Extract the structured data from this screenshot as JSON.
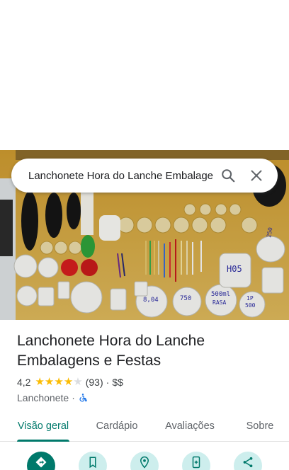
{
  "search": {
    "value": "Lanchonete Hora do Lanche Embalagens e Festas",
    "search_icon": "search-icon",
    "close_icon": "close-icon"
  },
  "place": {
    "name": "Lanchonete Hora do Lanche Embalagens e Festas",
    "rating": "4,2",
    "rating_value": 4.2,
    "stars_max": 5,
    "reviews_count": "(93)",
    "separator": "·",
    "price_level": "$$",
    "category": "Lanchonete",
    "category_separator": "·",
    "accessibility_icon": "wheelchair-icon"
  },
  "photo": {
    "sign_1": "H05",
    "sign_2": "500ml",
    "sign_2b": "RASA",
    "sign_3": "1P",
    "sign_3b": "500",
    "sign_4": "750",
    "sign_5": "8,04",
    "sign_6": "250"
  },
  "tabs": [
    {
      "label": "Visão geral",
      "active": true
    },
    {
      "label": "Cardápio",
      "active": false
    },
    {
      "label": "Avaliações",
      "active": false
    },
    {
      "label": "Sobre",
      "active": false
    }
  ],
  "actions": [
    {
      "icon": "directions-icon"
    },
    {
      "icon": "bookmark-icon"
    },
    {
      "icon": "nearby-icon"
    },
    {
      "icon": "send-to-phone-icon"
    },
    {
      "icon": "share-icon"
    }
  ],
  "colors": {
    "accent": "#00796b",
    "action_bg": "#cdeeed",
    "star": "#fbbc04",
    "wall": "#cfa23a"
  }
}
